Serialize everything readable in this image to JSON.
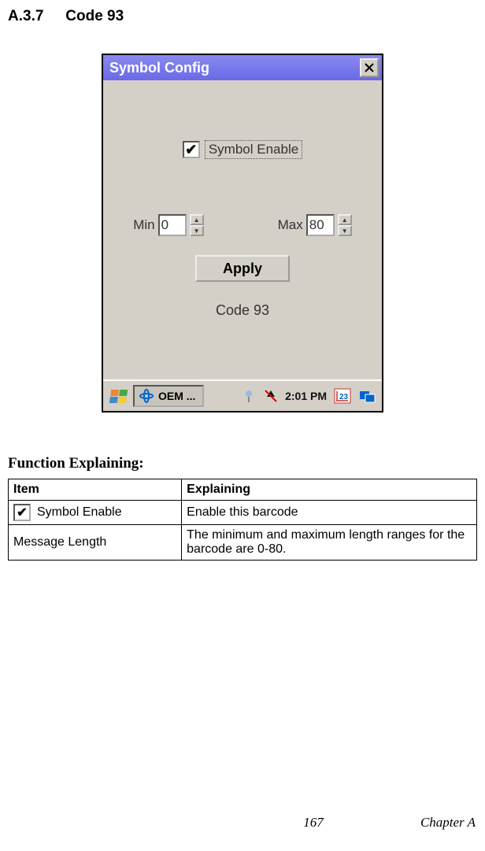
{
  "heading": {
    "number": "A.3.7",
    "title": "Code 93"
  },
  "dialog": {
    "title": "Symbol Config",
    "symbol_enable_label": "Symbol Enable",
    "symbol_enable_checked": true,
    "min_label": "Min",
    "min_value": "0",
    "max_label": "Max",
    "max_value": "80",
    "apply_label": "Apply",
    "code_label": "Code 93"
  },
  "taskbar": {
    "task_label": "OEM ...",
    "clock": "2:01 PM"
  },
  "function_heading": "Function Explaining:",
  "table": {
    "headers": {
      "item": "Item",
      "explaining": "Explaining"
    },
    "rows": [
      {
        "item": "Symbol Enable",
        "explaining": "Enable this barcode",
        "has_checkbox": true
      },
      {
        "item": "Message Length",
        "explaining": "The minimum and maximum length ranges for the barcode are 0-80.",
        "has_checkbox": false
      }
    ]
  },
  "footer": {
    "page": "167",
    "chapter": "Chapter A"
  }
}
